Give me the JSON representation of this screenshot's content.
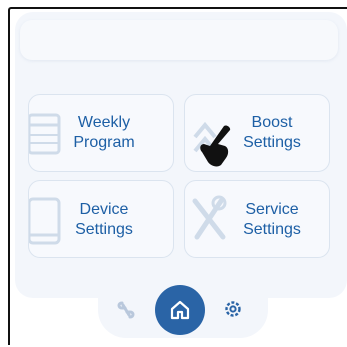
{
  "tiles": {
    "weekly_program": {
      "line1": "Weekly",
      "line2": "Program"
    },
    "boost_settings": {
      "line1": "Boost",
      "line2": "Settings"
    },
    "device_settings": {
      "line1": "Device",
      "line2": "Settings"
    },
    "service_settings": {
      "line1": "Service",
      "line2": "Settings"
    }
  },
  "nav": {
    "items": [
      {
        "icon": "link-icon",
        "active": false
      },
      {
        "icon": "home-icon",
        "active": true
      },
      {
        "icon": "gear-icon",
        "active": false
      }
    ]
  },
  "colors": {
    "accent": "#2a64a6",
    "label": "#1d5fa5",
    "panel_bg": "#f3f6fb",
    "tile_border": "#dbe4ef",
    "icon_watermark": "#cfdbe9"
  }
}
